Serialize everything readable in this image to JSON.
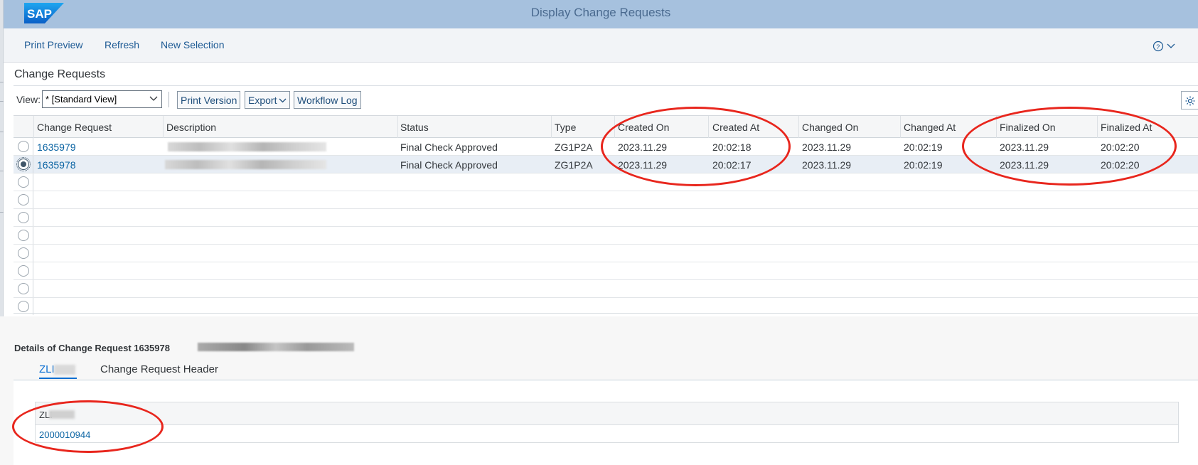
{
  "shell": {
    "logo_text": "SAP",
    "title": "Display Change Requests"
  },
  "toolbar": {
    "print_preview": "Print Preview",
    "refresh": "Refresh",
    "new_selection": "New Selection"
  },
  "section_title": "Change Requests",
  "alv": {
    "view_label": "View:",
    "view_value": "* [Standard View]",
    "print_version": "Print Version",
    "export": "Export",
    "workflow_log": "Workflow Log"
  },
  "columns": [
    "Change Request",
    "Description",
    "Status",
    "Type",
    "Created On",
    "Created At",
    "Changed On",
    "Changed At",
    "Finalized On",
    "Finalized At"
  ],
  "rows": [
    {
      "id": "1635979",
      "status": "Final Check Approved",
      "type": "ZG1P2A",
      "created_on": "2023.11.29",
      "created_at": "20:02:18",
      "changed_on": "2023.11.29",
      "changed_at": "20:02:19",
      "finalized_on": "2023.11.29",
      "finalized_at": "20:02:20",
      "selected": false
    },
    {
      "id": "1635978",
      "status": "Final Check Approved",
      "type": "ZG1P2A",
      "created_on": "2023.11.29",
      "created_at": "20:02:17",
      "changed_on": "2023.11.29",
      "changed_at": "20:02:19",
      "finalized_on": "2023.11.29",
      "finalized_at": "20:02:20",
      "selected": true
    }
  ],
  "details": {
    "title": "Details of Change Request 1635978",
    "tabs": [
      "ZLI",
      "Change Request Header"
    ],
    "sub_header": "ZLI",
    "sub_value": "2000010944"
  },
  "colors": {
    "shell_bg": "#a6c1de",
    "link": "#0b64a3",
    "annotation": "#e8261d"
  }
}
